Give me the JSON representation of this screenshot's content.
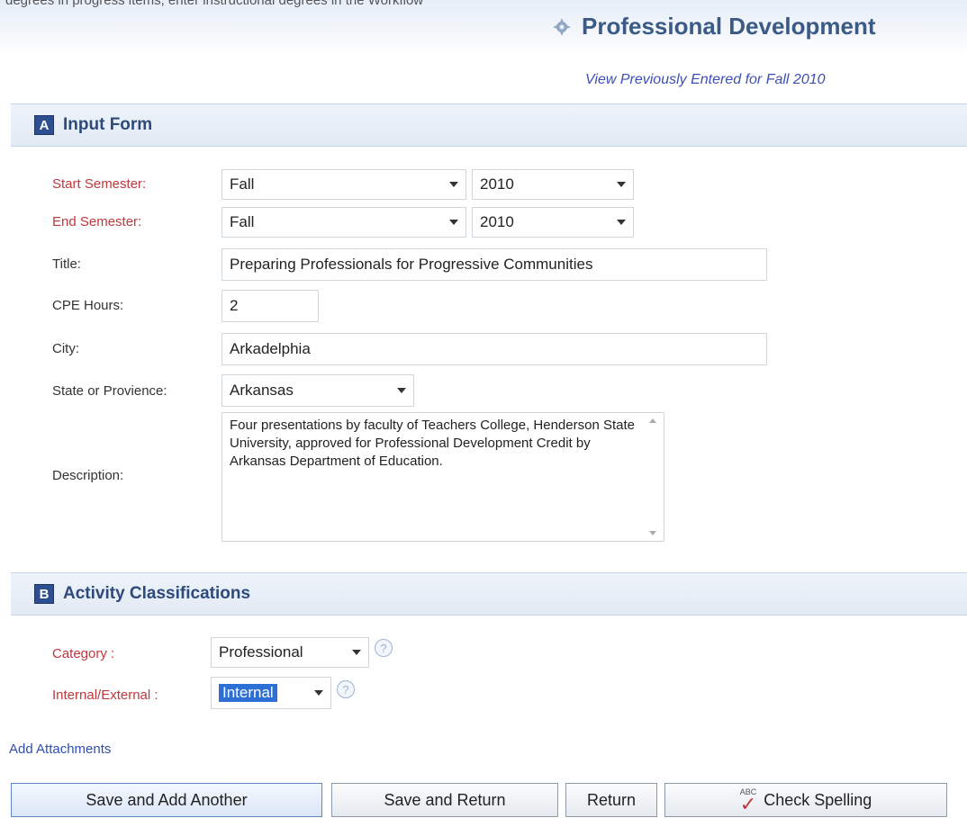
{
  "top_cut_text": "degrees in progress items, enter instructional degrees in the Workflow",
  "page_title": "Professional Development",
  "view_link": "View Previously Entered for Fall 2010",
  "section_a": {
    "badge": "A",
    "title": "Input Form"
  },
  "form": {
    "start_semester": {
      "label": "Start Semester:",
      "term": "Fall",
      "year": "2010"
    },
    "end_semester": {
      "label": "End Semester:",
      "term": "Fall",
      "year": "2010"
    },
    "title": {
      "label": "Title:",
      "value": "Preparing Professionals for Progressive Communities"
    },
    "cpe_hours": {
      "label": "CPE Hours:",
      "value": "2"
    },
    "city": {
      "label": "City:",
      "value": "Arkadelphia"
    },
    "state": {
      "label": "State or Provience:",
      "value": "Arkansas"
    },
    "description": {
      "label": "Description:",
      "value": "Four presentations by faculty of Teachers College, Henderson State University, approved for Professional Development Credit by Arkansas Department of Education."
    }
  },
  "section_b": {
    "badge": "B",
    "title": "Activity Classifications"
  },
  "classification": {
    "category": {
      "label": "Category :",
      "value": "Professional",
      "help": "?"
    },
    "internal_external": {
      "label": "Internal/External :",
      "value": "Internal",
      "help": "?"
    }
  },
  "add_attachments": "Add Attachments",
  "buttons": {
    "save_add_another": "Save and Add Another",
    "save_return": "Save and Return",
    "return": "Return",
    "check_spelling": "Check Spelling",
    "check_spelling_icon_text": "ABC"
  },
  "colors": {
    "required_label": "#c0373c",
    "section_badge": "#2e4f8f",
    "title_blue": "#3b5a86",
    "link_blue": "#3d4fb5",
    "selection": "#2e6fd6"
  }
}
